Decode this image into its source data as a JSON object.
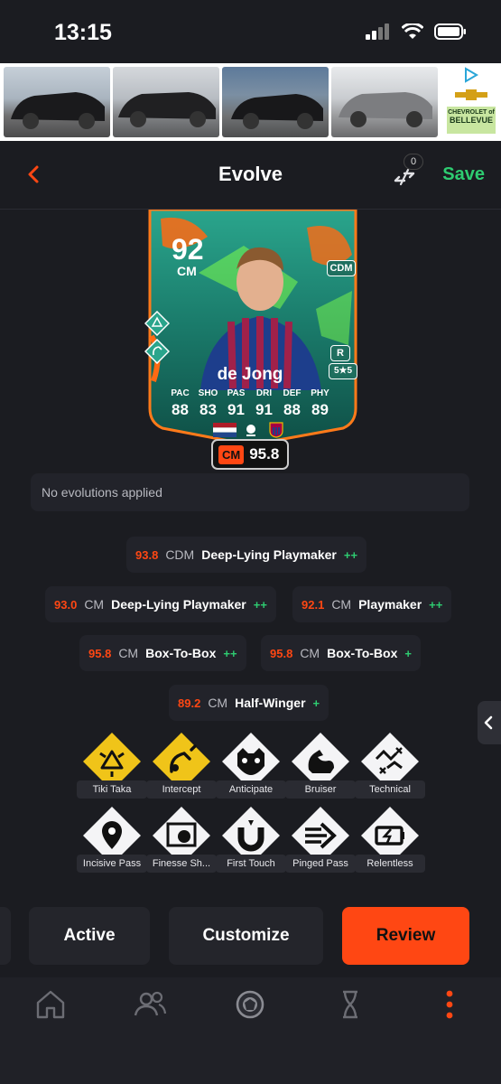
{
  "status_bar": {
    "time": "13:15"
  },
  "ad": {
    "brand_line": "CHEVROLET of",
    "dealer": "BELLEVUE"
  },
  "header": {
    "title": "Evolve",
    "compare_count": "0",
    "save_label": "Save"
  },
  "card": {
    "rating": "92",
    "position": "CM",
    "alt_position": "CDM",
    "foot": "R",
    "skill_moves": "5★5",
    "name": "de Jong",
    "stats": [
      {
        "label": "PAC",
        "value": "88"
      },
      {
        "label": "SHO",
        "value": "83"
      },
      {
        "label": "PAS",
        "value": "91"
      },
      {
        "label": "DRI",
        "value": "91"
      },
      {
        "label": "DEF",
        "value": "88"
      },
      {
        "label": "PHY",
        "value": "89"
      }
    ],
    "role_badge_pos": "CM",
    "role_badge_value": "95.8"
  },
  "evolutions_text": "No evolutions applied",
  "roles": [
    {
      "score": "93.8",
      "pos": "CDM",
      "name": "Deep-Lying Playmaker",
      "plus": "++"
    },
    {
      "score": "93.0",
      "pos": "CM",
      "name": "Deep-Lying Playmaker",
      "plus": "++"
    },
    {
      "score": "92.1",
      "pos": "CM",
      "name": "Playmaker",
      "plus": "++"
    },
    {
      "score": "95.8",
      "pos": "CM",
      "name": "Box-To-Box",
      "plus": "++"
    },
    {
      "score": "95.8",
      "pos": "CM",
      "name": "Box-To-Box",
      "plus": "+"
    },
    {
      "score": "89.2",
      "pos": "CM",
      "name": "Half-Winger",
      "plus": "+"
    }
  ],
  "playstyles": [
    {
      "label": "Tiki Taka",
      "plus": true,
      "icon": "tiki-taka-icon"
    },
    {
      "label": "Intercept",
      "plus": true,
      "icon": "intercept-icon"
    },
    {
      "label": "Anticipate",
      "plus": false,
      "icon": "anticipate-icon"
    },
    {
      "label": "Bruiser",
      "plus": false,
      "icon": "bruiser-icon"
    },
    {
      "label": "Technical",
      "plus": false,
      "icon": "technical-icon"
    },
    {
      "label": "Incisive Pass",
      "plus": false,
      "icon": "incisive-pass-icon"
    },
    {
      "label": "Finesse Sh...",
      "plus": false,
      "icon": "finesse-shot-icon"
    },
    {
      "label": "First Touch",
      "plus": false,
      "icon": "first-touch-icon"
    },
    {
      "label": "Pinged Pass",
      "plus": false,
      "icon": "pinged-pass-icon"
    },
    {
      "label": "Relentless",
      "plus": false,
      "icon": "relentless-icon"
    }
  ],
  "actions": {
    "active": "Active",
    "customize": "Customize",
    "review": "Review"
  },
  "colors": {
    "accent": "#ff4713",
    "save": "#2ecc71",
    "playstyle_plus": "#f0c419",
    "background": "#1b1c21"
  }
}
